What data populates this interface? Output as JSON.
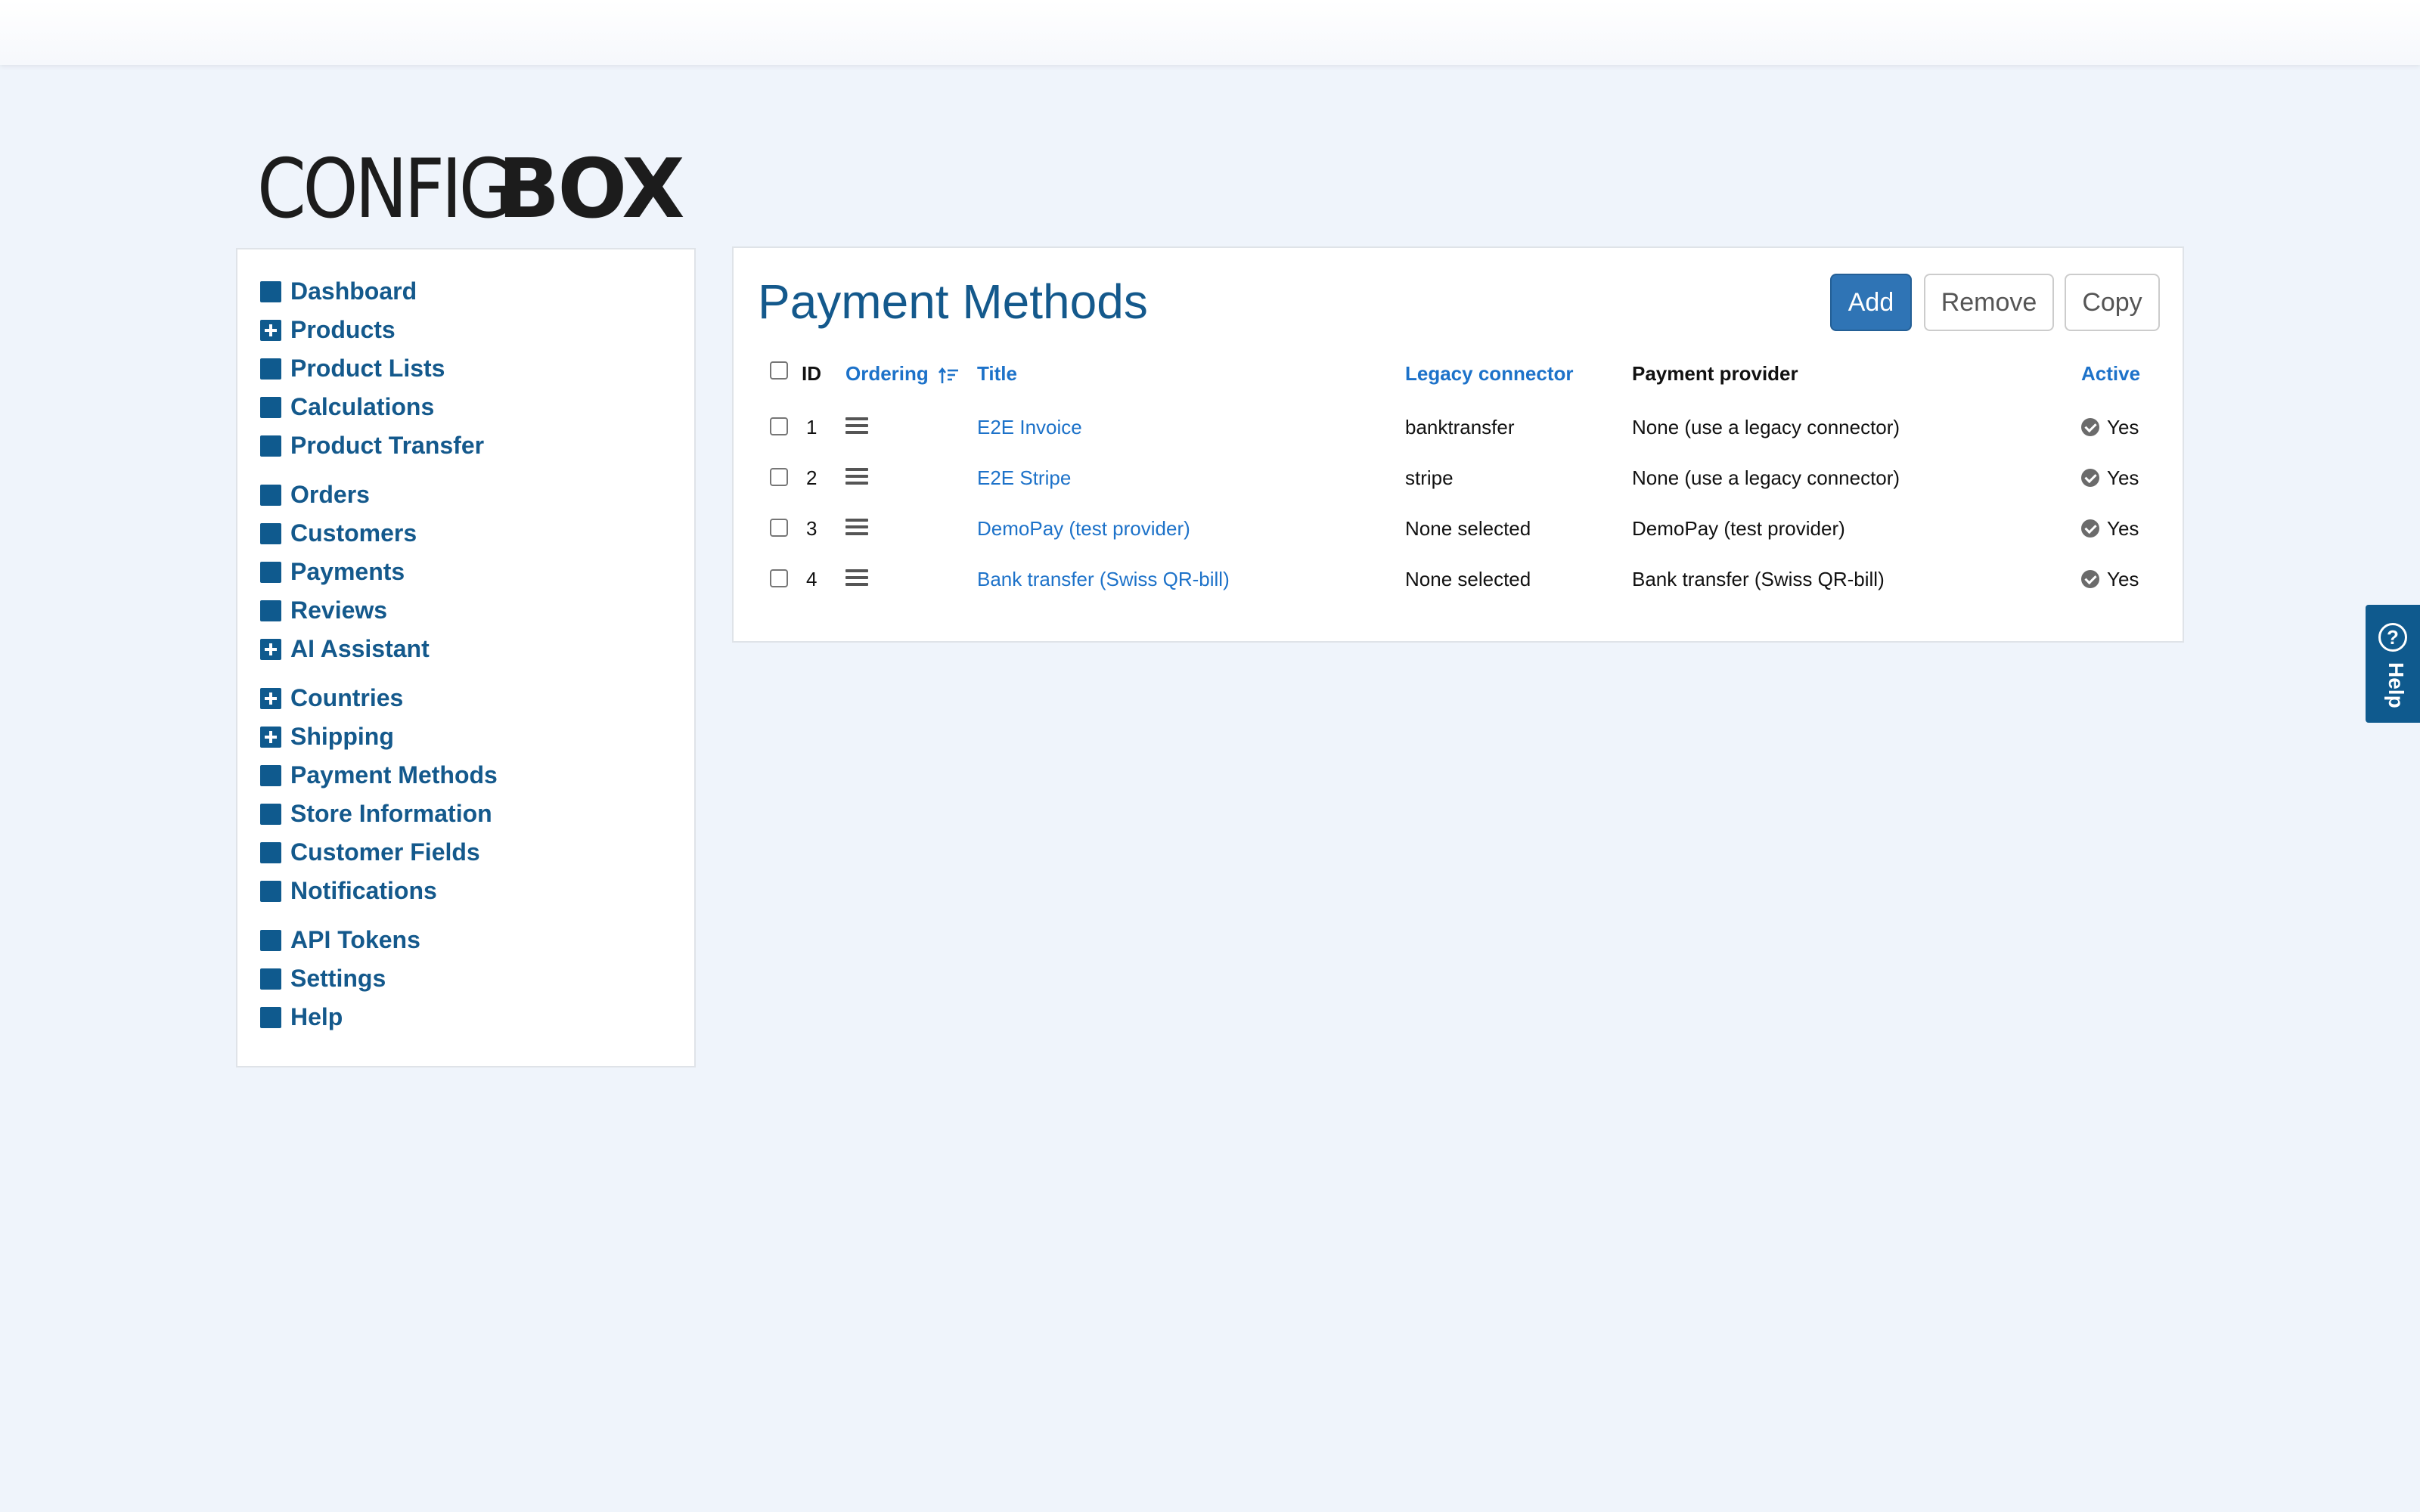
{
  "logo": {
    "part1": "CONFIG",
    "part2": "BOX"
  },
  "sidebar": {
    "groups": [
      [
        {
          "label": "Dashboard",
          "expandable": false
        },
        {
          "label": "Products",
          "expandable": true
        },
        {
          "label": "Product Lists",
          "expandable": false
        },
        {
          "label": "Calculations",
          "expandable": false
        },
        {
          "label": "Product Transfer",
          "expandable": false
        }
      ],
      [
        {
          "label": "Orders",
          "expandable": false
        },
        {
          "label": "Customers",
          "expandable": false
        },
        {
          "label": "Payments",
          "expandable": false
        },
        {
          "label": "Reviews",
          "expandable": false
        },
        {
          "label": "AI Assistant",
          "expandable": true
        }
      ],
      [
        {
          "label": "Countries",
          "expandable": true
        },
        {
          "label": "Shipping",
          "expandable": true
        },
        {
          "label": "Payment Methods",
          "expandable": false
        },
        {
          "label": "Store Information",
          "expandable": false
        },
        {
          "label": "Customer Fields",
          "expandable": false
        },
        {
          "label": "Notifications",
          "expandable": false
        }
      ],
      [
        {
          "label": "API Tokens",
          "expandable": false
        },
        {
          "label": "Settings",
          "expandable": false
        },
        {
          "label": "Help",
          "expandable": false
        }
      ]
    ]
  },
  "main": {
    "title": "Payment Methods",
    "buttons": {
      "add": "Add",
      "remove": "Remove",
      "copy": "Copy"
    },
    "columns": {
      "id": "ID",
      "ordering": "Ordering",
      "title": "Title",
      "legacy_connector": "Legacy connector",
      "payment_provider": "Payment provider",
      "active": "Active"
    },
    "rows": [
      {
        "id": "1",
        "title": "E2E Invoice",
        "legacy_connector": "banktransfer",
        "payment_provider": "None (use a legacy connector)",
        "active": "Yes"
      },
      {
        "id": "2",
        "title": "E2E Stripe",
        "legacy_connector": "stripe",
        "payment_provider": "None (use a legacy connector)",
        "active": "Yes"
      },
      {
        "id": "3",
        "title": "DemoPay (test provider)",
        "legacy_connector": "None selected",
        "payment_provider": "DemoPay (test provider)",
        "active": "Yes"
      },
      {
        "id": "4",
        "title": "Bank transfer (Swiss QR-bill)",
        "legacy_connector": "None selected",
        "payment_provider": "Bank transfer (Swiss QR-bill)",
        "active": "Yes"
      }
    ]
  },
  "help_tab": {
    "label": "Help",
    "glyph": "?"
  },
  "colors": {
    "brand": "#14598c",
    "link": "#1d72c9",
    "primary_button": "#2f74b5",
    "background": "#eff4fb"
  },
  "icons": [
    "square-bullet-icon",
    "plus-square-icon",
    "sort-ascending-icon",
    "drag-handle-icon",
    "check-circle-icon",
    "help-circle-icon"
  ]
}
